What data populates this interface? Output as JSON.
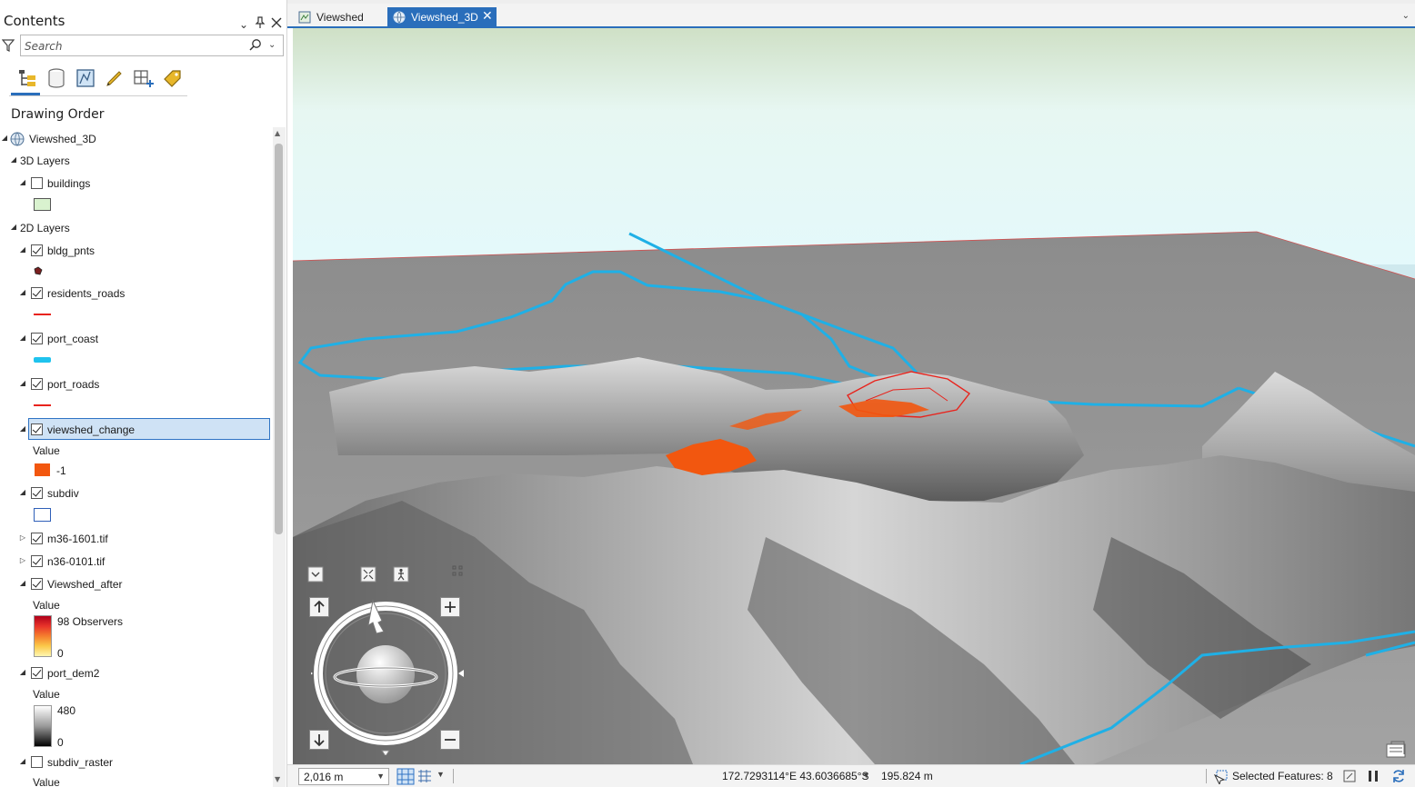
{
  "contents": {
    "title": "Contents",
    "search_placeholder": "Search",
    "drawing_order_label": "Drawing Order",
    "view_tabs": [
      "list-by-drawing-order",
      "list-by-data-source",
      "list-by-selection",
      "list-by-editing",
      "list-by-snapping",
      "list-by-labeling"
    ]
  },
  "tree": {
    "map": "Viewshed_3D",
    "group_3d": "3D Layers",
    "buildings": "buildings",
    "group_2d": "2D Layers",
    "bldg_pnts": "bldg_pnts",
    "residents_roads": "residents_roads",
    "port_coast": "port_coast",
    "port_roads": "port_roads",
    "viewshed_change": "viewshed_change",
    "viewshed_change_value_heading": "Value",
    "viewshed_change_value": "-1",
    "subdiv": "subdiv",
    "m36": "m36-1601.tif",
    "n36": "n36-0101.tif",
    "viewshed_after": "Viewshed_after",
    "viewshed_after_value_heading": "Value",
    "viewshed_after_high": "98 Observers",
    "viewshed_after_low": "0",
    "port_dem2": "port_dem2",
    "port_dem2_value_heading": "Value",
    "port_dem2_high": "480",
    "port_dem2_low": "0",
    "subdiv_raster": "subdiv_raster",
    "subdiv_raster_partial": "Value"
  },
  "map_tabs": {
    "tab1": "Viewshed",
    "tab2": "Viewshed_3D"
  },
  "status": {
    "scale": "2,016 m",
    "coordinates": "172.7293114°E 43.6036685°S",
    "elevation": "195.824 m",
    "selected_features": "Selected Features: 8"
  },
  "colors": {
    "accent": "#2a6ebb",
    "selection_fill": "#cfe2f5",
    "coast": "#1fb0e6",
    "roads": "#e8231c",
    "viewshed_change": "#f2570f"
  }
}
